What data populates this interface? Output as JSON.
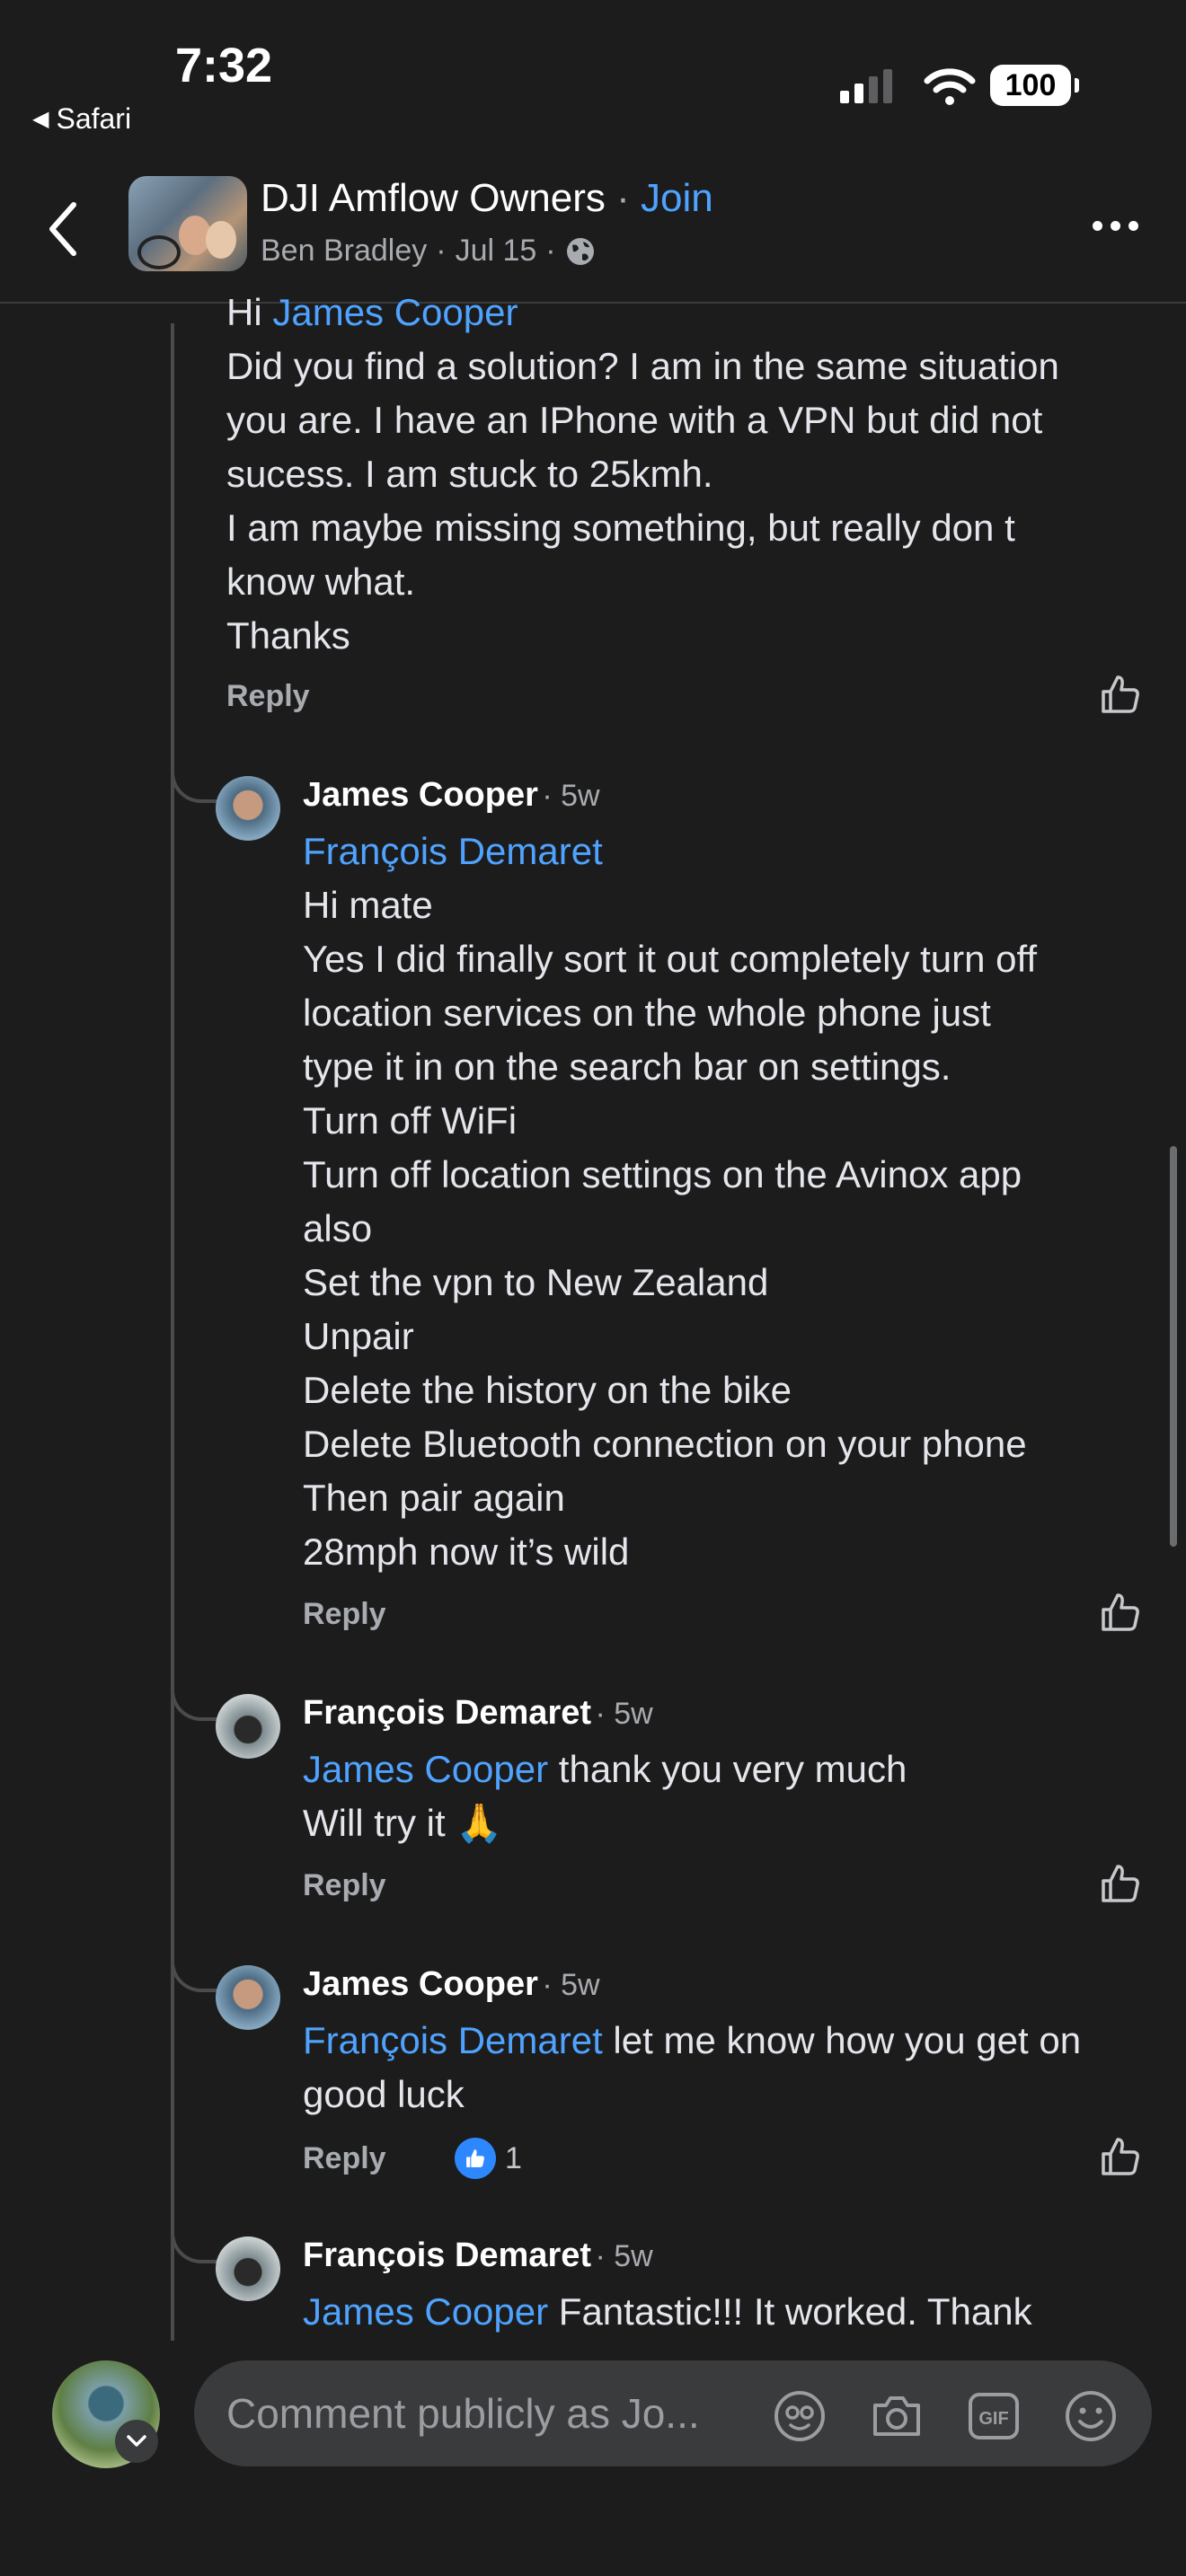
{
  "status_bar": {
    "time": "7:32",
    "back_app": "Safari",
    "battery": "100"
  },
  "header": {
    "group_name": "DJI Amflow Owners",
    "separator": " · ",
    "join_label": "Join",
    "author": "Ben Bradley",
    "date": "Jul 15",
    "dot": "·"
  },
  "comments": [
    {
      "lines": [
        {
          "mention": "James Cooper",
          "prefix": "Hi "
        },
        {
          "text": "Did you find a solution? I am in the same situation"
        },
        {
          "text": "you are. I have an IPhone with a VPN but did not"
        },
        {
          "text": "sucess. I am stuck to 25kmh."
        },
        {
          "text": "I am maybe missing something, but really don t"
        },
        {
          "text": "know what."
        },
        {
          "text": "Thanks"
        }
      ],
      "reply": "Reply"
    },
    {
      "author": "James Cooper",
      "age": "· 5w",
      "mention": "François Demaret",
      "lines": [
        "Hi mate",
        "Yes I did finally sort it out completely turn off",
        "location services on the whole phone just",
        "type it in on the search bar on settings.",
        "Turn off WiFi",
        "Turn off location settings on the Avinox app",
        "also",
        "Set the vpn to New Zealand",
        "Unpair",
        "Delete the history on the bike",
        "Delete Bluetooth connection on your phone",
        "Then pair again",
        "28mph now it’s wild"
      ],
      "reply": "Reply"
    },
    {
      "author": "François Demaret",
      "age": "· 5w",
      "mention": "James Cooper",
      "after_mention": " thank you very much",
      "line2": "Will try it 🙏",
      "reply": "Reply"
    },
    {
      "author": "James Cooper",
      "age": "· 5w",
      "mention": "François Demaret",
      "after_mention": " let me know how you get on",
      "line2": "good luck",
      "reply": "Reply",
      "like_count": "1"
    },
    {
      "author": "François Demaret",
      "age": "· 5w",
      "mention": "James Cooper",
      "after_mention": " Fantastic!!! It worked. Thank"
    }
  ],
  "composer": {
    "placeholder": "Comment publicly as Jo..."
  },
  "icons": [
    "back-arrow-icon",
    "globe-icon",
    "more-icon",
    "like-icon",
    "avatar-sticker-icon",
    "camera-icon",
    "gif-icon",
    "emoji-icon",
    "chevron-down-icon"
  ]
}
